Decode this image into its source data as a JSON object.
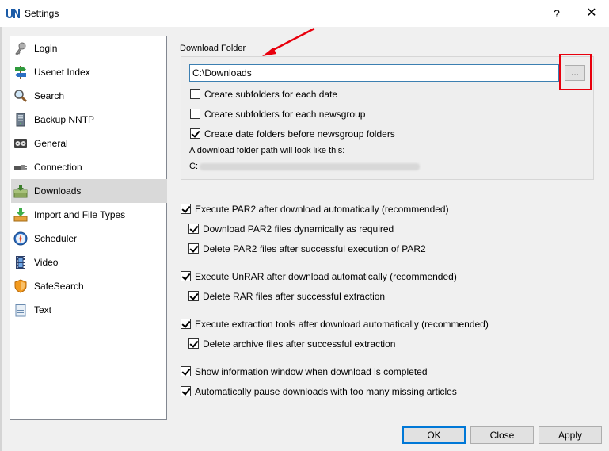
{
  "window": {
    "title": "Settings",
    "help_glyph": "?",
    "close_glyph": "✕"
  },
  "nav": {
    "items": [
      {
        "label": "Login",
        "icon": "key-icon"
      },
      {
        "label": "Usenet Index",
        "icon": "signpost-icon"
      },
      {
        "label": "Search",
        "icon": "magnifier-icon"
      },
      {
        "label": "Backup NNTP",
        "icon": "server-icon"
      },
      {
        "label": "General",
        "icon": "tape-icon"
      },
      {
        "label": "Connection",
        "icon": "plug-icon"
      },
      {
        "label": "Downloads",
        "icon": "download-box-icon"
      },
      {
        "label": "Import and File Types",
        "icon": "import-icon"
      },
      {
        "label": "Scheduler",
        "icon": "compass-icon"
      },
      {
        "label": "Video",
        "icon": "film-icon"
      },
      {
        "label": "SafeSearch",
        "icon": "shield-icon"
      },
      {
        "label": "Text",
        "icon": "notepad-icon"
      }
    ],
    "selected": "Downloads"
  },
  "download_folder": {
    "group_label": "Download Folder",
    "path_value": "C:\\Downloads",
    "browse_label": "...",
    "options": [
      {
        "label": "Create subfolders for each date",
        "checked": false
      },
      {
        "label": "Create subfolders for each newsgroup",
        "checked": false
      },
      {
        "label": "Create date folders before newsgroup folders",
        "checked": true
      }
    ],
    "example_label": "A download folder path will look like this:",
    "example_prefix": "C:"
  },
  "options": [
    {
      "label": "Execute PAR2 after download automatically (recommended)",
      "checked": true
    },
    {
      "label": "Download PAR2 files dynamically as required",
      "checked": true
    },
    {
      "label": "Delete PAR2 files after successful execution of PAR2",
      "checked": true
    },
    {
      "label": "Execute UnRAR after download automatically (recommended)",
      "checked": true
    },
    {
      "label": "Delete RAR files after successful extraction",
      "checked": true
    },
    {
      "label": "Execute extraction tools after download automatically (recommended)",
      "checked": true
    },
    {
      "label": "Delete archive files after successful extraction",
      "checked": true
    },
    {
      "label": "Show information window when download is completed",
      "checked": true
    },
    {
      "label": "Automatically pause downloads with too many missing articles",
      "checked": true
    }
  ],
  "buttons": {
    "ok": "OK",
    "close": "Close",
    "apply": "Apply"
  },
  "colors": {
    "highlight": "#e8000d",
    "accent": "#0078d7",
    "selected_bg": "#d9d9d9"
  }
}
